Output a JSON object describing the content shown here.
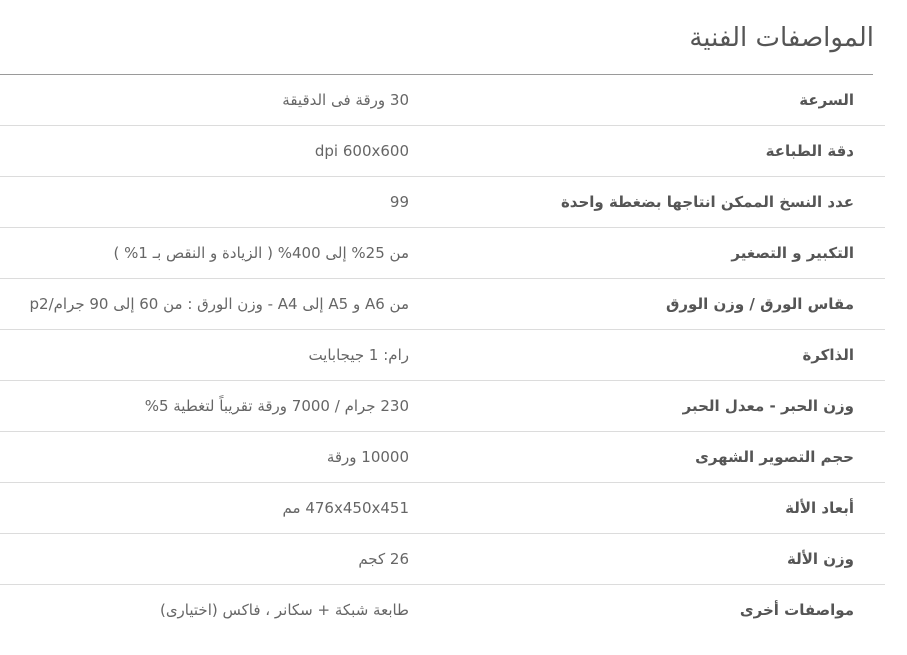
{
  "title": "المواصفات الفنية",
  "specs": [
    {
      "label": "السرعة",
      "value": "30 ورقة فى الدقيقة"
    },
    {
      "label": "دقة الطباعة",
      "value": "dpi 600x600"
    },
    {
      "label": "عدد النسخ الممكن انتاجها بضغطة واحدة",
      "value": "99"
    },
    {
      "label": "التكبير و التصغير",
      "value": "من 25% إلى 400% ( الزيادة و النقص بـ 1% )"
    },
    {
      "label": "مقاس الورق / وزن الورق",
      "value": "من A6 و A5 إلى A4 - وزن الورق : من 60 إلى 90 جرام/p2"
    },
    {
      "label": "الذاكرة",
      "value": "رام: 1 جيجابايت"
    },
    {
      "label": "وزن الحبر - معدل الحبر",
      "value": "230 جرام / 7000 ورقة تقريباً لتغطية 5%"
    },
    {
      "label": "حجم التصوير الشهرى",
      "value": "10000 ورقة"
    },
    {
      "label": "أبعاد الألة",
      "value": "476x450x451 مم"
    },
    {
      "label": "وزن الألة",
      "value": "26 كجم"
    },
    {
      "label": "مواصفات أخرى",
      "value": "طابعة شبكة + سكانر ، فاكس (اختيارى)"
    }
  ]
}
